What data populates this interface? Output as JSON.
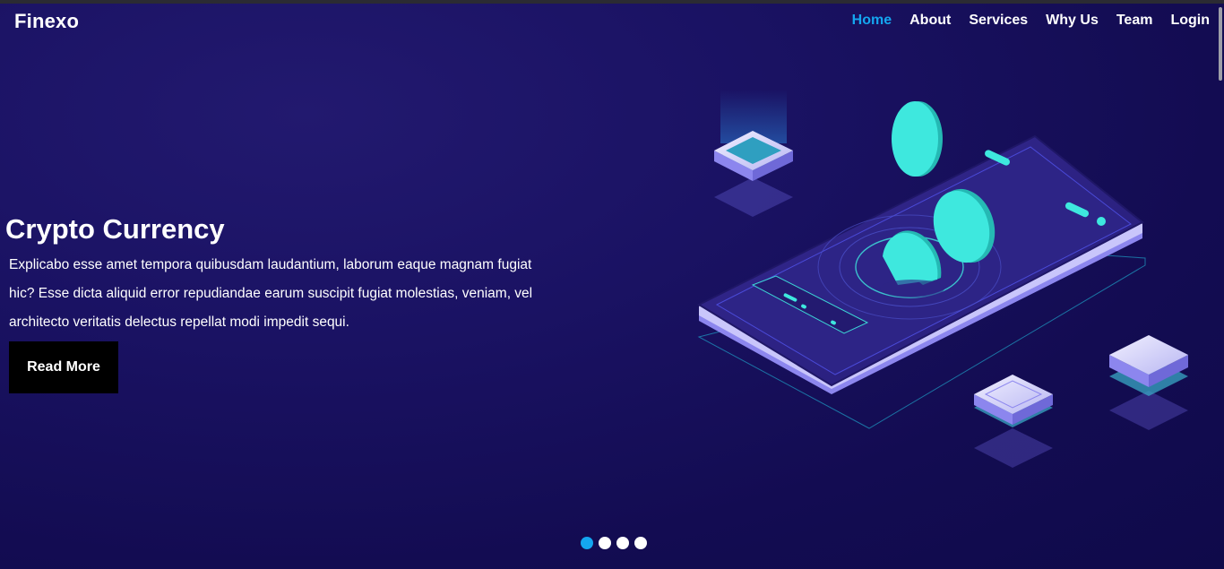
{
  "header": {
    "brand": "Finexo",
    "nav": [
      {
        "label": "Home",
        "active": true
      },
      {
        "label": "About"
      },
      {
        "label": "Services"
      },
      {
        "label": "Why Us"
      },
      {
        "label": "Team"
      },
      {
        "label": "Login"
      }
    ]
  },
  "hero": {
    "title": "Crypto Currency",
    "text": "Explicabo esse amet tempora quibusdam laudantium, laborum eaque magnam fugiat hic? Esse dicta aliquid error repudiandae earum suscipit fugiat molestias, veniam, vel architecto veritatis delectus repellat modi impedit sequi.",
    "button_label": "Read More"
  },
  "slider": {
    "count": 4,
    "active_index": 0
  },
  "colors": {
    "background": "#130c52",
    "accent": "#14a6f0",
    "coin": "#3ee8de",
    "phone": "#2c2385"
  }
}
